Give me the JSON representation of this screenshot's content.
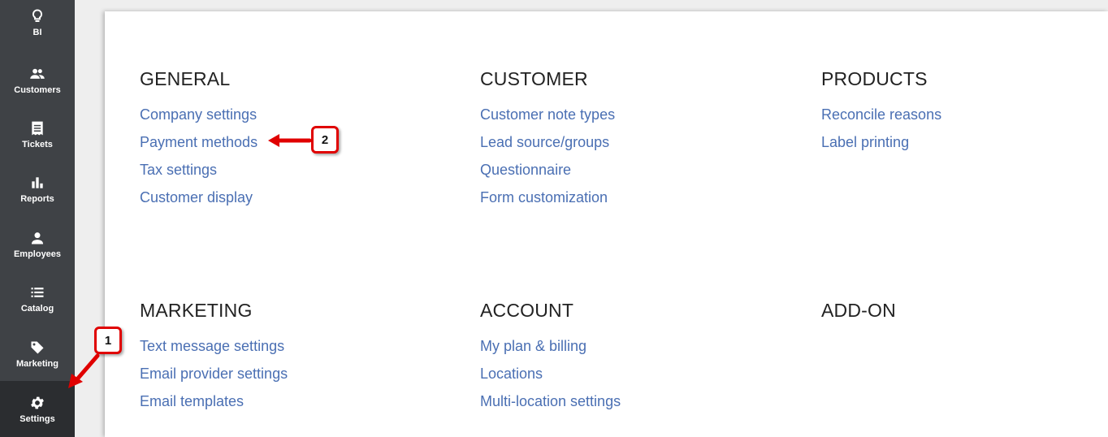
{
  "sidebar": {
    "items": [
      {
        "label": "BI",
        "icon": "lightbulb-icon"
      },
      {
        "label": "Customers",
        "icon": "people-icon"
      },
      {
        "label": "Tickets",
        "icon": "receipt-icon"
      },
      {
        "label": "Reports",
        "icon": "bar-chart-icon"
      },
      {
        "label": "Employees",
        "icon": "person-icon"
      },
      {
        "label": "Catalog",
        "icon": "list-icon"
      },
      {
        "label": "Marketing",
        "icon": "tag-icon"
      },
      {
        "label": "Settings",
        "icon": "gear-icon",
        "active": true
      }
    ]
  },
  "sections": {
    "general": {
      "title": "GENERAL",
      "links": [
        "Company settings",
        "Payment methods",
        "Tax settings",
        "Customer display"
      ]
    },
    "customer": {
      "title": "CUSTOMER",
      "links": [
        "Customer note types",
        "Lead source/groups",
        "Questionnaire",
        "Form customization"
      ]
    },
    "products": {
      "title": "PRODUCTS",
      "links": [
        "Reconcile reasons",
        "Label printing"
      ]
    },
    "marketing": {
      "title": "MARKETING",
      "links": [
        "Text message settings",
        "Email provider settings",
        "Email templates"
      ]
    },
    "account": {
      "title": "ACCOUNT",
      "links": [
        "My plan & billing",
        "Locations",
        "Multi-location settings"
      ]
    },
    "addon": {
      "title": "ADD-ON",
      "links": []
    }
  },
  "annotations": {
    "step1": "1",
    "step2": "2"
  },
  "colors": {
    "sidebar": "#3f4246",
    "sidebar_active": "#2b2d30",
    "link": "#4a6fb3",
    "annotation": "#e00000"
  }
}
